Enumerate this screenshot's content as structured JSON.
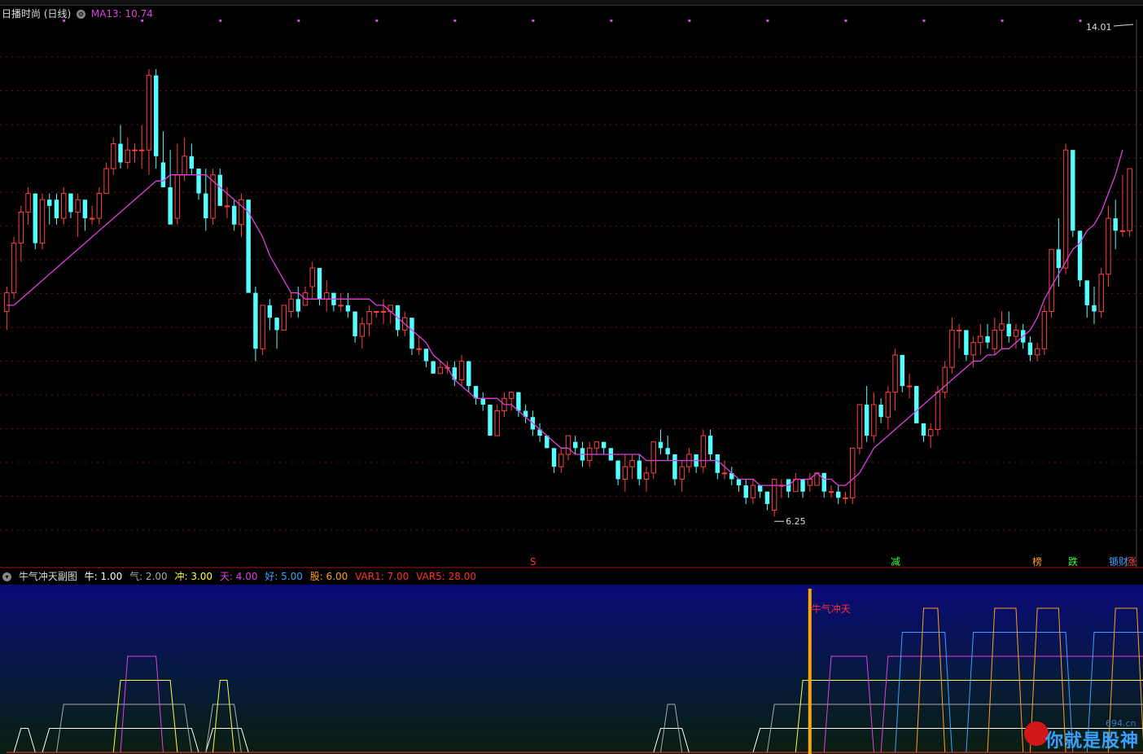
{
  "title": "日播时尚 (日线)",
  "ma": {
    "label": "MA13: 10.74",
    "color": "#e040e0"
  },
  "price_labels": {
    "high": "14.01",
    "low": "6.25"
  },
  "markers": {
    "s": "S",
    "jian": "减",
    "mai": "榜",
    "die": "跌",
    "cai": "锧财",
    "zhang": "涨"
  },
  "sub": {
    "title": "牛气冲天副图",
    "items": [
      {
        "label": "牛: 1.00",
        "color": "#ffffff"
      },
      {
        "label": "气: 2.00",
        "color": "#aaaaaa"
      },
      {
        "label": "冲: 3.00",
        "color": "#ffff40"
      },
      {
        "label": "天: 4.00",
        "color": "#e040e0"
      },
      {
        "label": "好: 5.00",
        "color": "#40a0ff"
      },
      {
        "label": "股: 6.00",
        "color": "#ffa020"
      },
      {
        "label": "VAR1: 7.00",
        "color": "#ff3030"
      },
      {
        "label": "VAR5: 28.00",
        "color": "#ff3030"
      }
    ],
    "signal_label": "牛气冲天"
  },
  "watermark": {
    "text": "你就是股神",
    "site": "694.cn"
  },
  "chart_data": {
    "type": "candlestick",
    "title": "日播时尚 (日线)",
    "up_color": "#ff4040",
    "down_color": "#54ffff",
    "ma_color": "#e040e0",
    "y_range": [
      5.7,
      14.3
    ],
    "candles": [
      [
        9.6,
        10.0,
        9.3,
        9.9
      ],
      [
        9.9,
        10.8,
        9.8,
        10.7
      ],
      [
        10.7,
        11.3,
        10.4,
        11.2
      ],
      [
        11.2,
        11.6,
        11.0,
        11.5
      ],
      [
        11.5,
        11.3,
        10.6,
        10.7
      ],
      [
        10.7,
        11.5,
        10.6,
        11.4
      ],
      [
        11.4,
        11.5,
        11.0,
        11.3
      ],
      [
        11.4,
        11.5,
        11.0,
        11.1
      ],
      [
        11.1,
        11.6,
        11.0,
        11.5
      ],
      [
        11.5,
        11.4,
        11.1,
        11.2
      ],
      [
        11.2,
        11.5,
        10.8,
        11.4
      ],
      [
        11.4,
        11.4,
        10.9,
        11.1
      ],
      [
        11.1,
        11.3,
        11.0,
        11.1
      ],
      [
        11.1,
        11.6,
        11.0,
        11.5
      ],
      [
        11.5,
        12.0,
        11.5,
        11.9
      ],
      [
        11.9,
        12.4,
        11.8,
        12.3
      ],
      [
        12.3,
        12.6,
        11.9,
        12.0
      ],
      [
        12.0,
        12.4,
        11.9,
        12.2
      ],
      [
        12.2,
        12.3,
        12.0,
        12.2
      ],
      [
        12.2,
        12.6,
        11.9,
        12.2
      ],
      [
        12.2,
        13.5,
        11.8,
        13.4
      ],
      [
        13.4,
        13.5,
        11.9,
        12.1
      ],
      [
        12.0,
        12.5,
        11.6,
        11.6
      ],
      [
        11.6,
        12.2,
        11.0,
        11.0
      ],
      [
        11.1,
        12.3,
        11.0,
        11.8
      ],
      [
        11.8,
        12.4,
        11.7,
        12.1
      ],
      [
        12.1,
        12.3,
        11.8,
        11.9
      ],
      [
        11.9,
        11.8,
        11.4,
        11.5
      ],
      [
        11.5,
        11.9,
        10.9,
        11.1
      ],
      [
        11.1,
        11.9,
        11.0,
        11.8
      ],
      [
        11.8,
        11.9,
        11.3,
        11.3
      ],
      [
        11.3,
        11.6,
        11.1,
        11.3
      ],
      [
        11.3,
        11.4,
        10.9,
        11.0
      ],
      [
        11.0,
        11.5,
        10.8,
        11.4
      ],
      [
        11.4,
        11.3,
        9.9,
        9.9
      ],
      [
        9.9,
        10.0,
        8.8,
        9.0
      ],
      [
        9.0,
        9.7,
        8.9,
        9.7
      ],
      [
        9.7,
        9.8,
        9.3,
        9.5
      ],
      [
        9.5,
        9.4,
        9.0,
        9.3
      ],
      [
        9.3,
        9.7,
        9.3,
        9.7
      ],
      [
        9.6,
        9.9,
        9.5,
        9.8
      ],
      [
        9.8,
        10.0,
        9.5,
        9.6
      ],
      [
        9.7,
        10.0,
        9.7,
        9.9
      ],
      [
        10.0,
        10.4,
        9.8,
        10.3
      ],
      [
        10.3,
        10.3,
        9.7,
        9.8
      ],
      [
        9.8,
        10.1,
        9.6,
        9.9
      ],
      [
        9.9,
        9.9,
        9.6,
        9.7
      ],
      [
        9.7,
        9.9,
        9.6,
        9.7
      ],
      [
        9.7,
        9.9,
        9.5,
        9.6
      ],
      [
        9.6,
        9.6,
        9.1,
        9.2
      ],
      [
        9.2,
        9.5,
        9.0,
        9.4
      ],
      [
        9.4,
        9.7,
        9.2,
        9.6
      ],
      [
        9.6,
        9.6,
        9.5,
        9.6
      ],
      [
        9.6,
        9.8,
        9.4,
        9.6
      ],
      [
        9.6,
        9.6,
        9.4,
        9.7
      ],
      [
        9.7,
        9.6,
        9.2,
        9.3
      ],
      [
        9.3,
        9.6,
        9.2,
        9.5
      ],
      [
        9.5,
        9.3,
        8.9,
        9.0
      ],
      [
        9.0,
        9.2,
        8.9,
        9.0
      ],
      [
        9.0,
        8.9,
        8.7,
        8.8
      ],
      [
        8.8,
        8.8,
        8.6,
        8.6
      ],
      [
        8.6,
        8.8,
        8.6,
        8.7
      ],
      [
        8.7,
        8.8,
        8.6,
        8.7
      ],
      [
        8.7,
        8.8,
        8.4,
        8.5
      ],
      [
        8.5,
        8.9,
        8.4,
        8.8
      ],
      [
        8.8,
        8.8,
        8.3,
        8.4
      ],
      [
        8.4,
        8.4,
        8.1,
        8.2
      ],
      [
        8.2,
        8.3,
        8.0,
        8.1
      ],
      [
        8.1,
        8.1,
        7.6,
        7.6
      ],
      [
        7.6,
        8.1,
        7.6,
        8.0
      ],
      [
        8.0,
        8.3,
        7.9,
        8.2
      ],
      [
        8.2,
        8.3,
        8.0,
        8.3
      ],
      [
        8.3,
        8.3,
        7.9,
        8.0
      ],
      [
        8.0,
        8.1,
        7.8,
        7.9
      ],
      [
        7.9,
        8.0,
        7.6,
        7.7
      ],
      [
        7.7,
        7.8,
        7.5,
        7.6
      ],
      [
        7.6,
        7.6,
        7.4,
        7.4
      ],
      [
        7.4,
        7.3,
        7.0,
        7.1
      ],
      [
        7.1,
        7.4,
        7.0,
        7.3
      ],
      [
        7.3,
        7.6,
        7.2,
        7.6
      ],
      [
        7.5,
        7.6,
        7.3,
        7.4
      ],
      [
        7.4,
        7.5,
        7.1,
        7.2
      ],
      [
        7.2,
        7.5,
        7.1,
        7.4
      ],
      [
        7.4,
        7.5,
        7.3,
        7.5
      ],
      [
        7.5,
        7.5,
        7.3,
        7.4
      ],
      [
        7.4,
        7.4,
        7.2,
        7.2
      ],
      [
        7.2,
        7.2,
        6.8,
        6.9
      ],
      [
        6.9,
        7.3,
        6.7,
        7.1
      ],
      [
        7.1,
        7.3,
        6.9,
        7.2
      ],
      [
        7.2,
        7.3,
        6.8,
        6.9
      ],
      [
        6.9,
        7.1,
        6.7,
        7.0
      ],
      [
        7.0,
        7.5,
        6.9,
        7.5
      ],
      [
        7.5,
        7.7,
        7.3,
        7.4
      ],
      [
        7.4,
        7.6,
        7.2,
        7.3
      ],
      [
        7.3,
        7.3,
        6.8,
        6.9
      ],
      [
        6.9,
        7.2,
        6.7,
        7.1
      ],
      [
        7.1,
        7.4,
        7.0,
        7.3
      ],
      [
        7.3,
        7.3,
        7.0,
        7.1
      ],
      [
        7.1,
        7.7,
        7.0,
        7.6
      ],
      [
        7.6,
        7.7,
        7.2,
        7.3
      ],
      [
        7.3,
        7.2,
        6.9,
        7.0
      ],
      [
        7.0,
        7.2,
        6.9,
        7.0
      ],
      [
        7.0,
        7.1,
        6.8,
        6.9
      ],
      [
        6.9,
        6.9,
        6.7,
        6.8
      ],
      [
        6.8,
        6.9,
        6.5,
        6.6
      ],
      [
        6.6,
        6.9,
        6.5,
        6.8
      ],
      [
        6.8,
        6.8,
        6.6,
        6.7
      ],
      [
        6.7,
        6.7,
        6.4,
        6.5
      ],
      [
        6.4,
        6.9,
        6.3,
        6.9
      ],
      [
        6.8,
        6.9,
        6.6,
        6.8
      ],
      [
        6.9,
        6.8,
        6.6,
        6.7
      ],
      [
        6.7,
        7.0,
        6.7,
        6.9
      ],
      [
        6.9,
        6.9,
        6.6,
        6.7
      ],
      [
        6.8,
        7.0,
        6.7,
        6.9
      ],
      [
        6.8,
        7.0,
        6.8,
        7.0
      ],
      [
        7.0,
        6.9,
        6.6,
        6.7
      ],
      [
        6.7,
        6.8,
        6.6,
        6.7
      ],
      [
        6.7,
        6.8,
        6.5,
        6.6
      ],
      [
        6.6,
        6.7,
        6.5,
        6.6
      ],
      [
        6.6,
        7.4,
        6.5,
        7.4
      ],
      [
        7.4,
        8.1,
        7.3,
        8.1
      ],
      [
        8.1,
        8.4,
        7.5,
        7.6
      ],
      [
        7.6,
        8.3,
        7.5,
        8.1
      ],
      [
        8.1,
        8.2,
        7.8,
        7.9
      ],
      [
        7.9,
        8.4,
        7.7,
        8.3
      ],
      [
        8.3,
        9.0,
        8.0,
        8.9
      ],
      [
        8.9,
        8.8,
        8.3,
        8.4
      ],
      [
        8.4,
        8.6,
        8.2,
        8.4
      ],
      [
        8.4,
        8.4,
        7.8,
        7.8
      ],
      [
        7.8,
        7.7,
        7.5,
        7.6
      ],
      [
        7.6,
        7.8,
        7.4,
        7.7
      ],
      [
        7.7,
        8.4,
        7.6,
        8.3
      ],
      [
        8.3,
        8.8,
        8.2,
        8.7
      ],
      [
        8.7,
        9.5,
        8.6,
        9.3
      ],
      [
        9.3,
        9.4,
        9.0,
        9.3
      ],
      [
        9.3,
        9.2,
        8.8,
        8.9
      ],
      [
        8.9,
        9.2,
        8.7,
        9.1
      ],
      [
        9.1,
        9.4,
        8.9,
        9.2
      ],
      [
        9.2,
        9.4,
        9.0,
        9.1
      ],
      [
        9.0,
        9.5,
        8.9,
        9.3
      ],
      [
        9.3,
        9.6,
        9.0,
        9.4
      ],
      [
        9.4,
        9.6,
        9.1,
        9.2
      ],
      [
        9.2,
        9.4,
        9.0,
        9.3
      ],
      [
        9.3,
        9.4,
        9.0,
        9.1
      ],
      [
        9.1,
        9.2,
        8.8,
        8.9
      ],
      [
        8.9,
        9.1,
        8.8,
        9.0
      ],
      [
        9.0,
        9.7,
        8.9,
        9.6
      ],
      [
        9.6,
        10.6,
        9.5,
        10.6
      ],
      [
        10.6,
        11.1,
        10.0,
        10.3
      ],
      [
        10.3,
        12.3,
        10.2,
        12.2
      ],
      [
        12.2,
        12.2,
        10.8,
        10.9
      ],
      [
        10.9,
        10.8,
        10.0,
        10.1
      ],
      [
        10.1,
        10.1,
        9.5,
        9.7
      ],
      [
        9.7,
        10.0,
        9.4,
        9.6
      ],
      [
        9.6,
        10.3,
        9.5,
        10.2
      ],
      [
        10.2,
        11.3,
        10.0,
        11.1
      ],
      [
        11.1,
        11.4,
        10.6,
        10.9
      ],
      [
        10.9,
        11.8,
        10.8,
        10.9
      ],
      [
        10.9,
        11.9,
        10.8,
        11.9
      ]
    ],
    "ma13_line": [
      9.7,
      9.7,
      9.8,
      9.9,
      10.0,
      10.1,
      10.2,
      10.3,
      10.4,
      10.5,
      10.6,
      10.7,
      10.8,
      10.9,
      11.0,
      11.1,
      11.2,
      11.3,
      11.4,
      11.5,
      11.6,
      11.7,
      11.7,
      11.8,
      11.8,
      11.8,
      11.8,
      11.8,
      11.8,
      11.7,
      11.6,
      11.5,
      11.4,
      11.3,
      11.2,
      11.0,
      10.8,
      10.5,
      10.3,
      10.1,
      9.9,
      9.9,
      9.8,
      9.8,
      9.8,
      9.8,
      9.8,
      9.8,
      9.8,
      9.8,
      9.8,
      9.8,
      9.7,
      9.7,
      9.6,
      9.5,
      9.4,
      9.3,
      9.2,
      9.1,
      8.9,
      8.8,
      8.7,
      8.5,
      8.4,
      8.3,
      8.2,
      8.2,
      8.2,
      8.2,
      8.1,
      8.1,
      8.0,
      7.9,
      7.8,
      7.7,
      7.6,
      7.5,
      7.4,
      7.4,
      7.3,
      7.3,
      7.3,
      7.3,
      7.3,
      7.3,
      7.3,
      7.3,
      7.3,
      7.3,
      7.2,
      7.2,
      7.2,
      7.2,
      7.2,
      7.2,
      7.2,
      7.2,
      7.2,
      7.2,
      7.2,
      7.1,
      7.0,
      6.9,
      6.9,
      6.9,
      6.8,
      6.8,
      6.8,
      6.8,
      6.8,
      6.9,
      6.9,
      6.9,
      7.0,
      6.9,
      6.9,
      6.8,
      6.8,
      6.9,
      7.0,
      7.2,
      7.4,
      7.5,
      7.6,
      7.7,
      7.8,
      7.9,
      8.0,
      8.1,
      8.2,
      8.3,
      8.4,
      8.5,
      8.6,
      8.7,
      8.8,
      8.8,
      8.9,
      8.9,
      9.0,
      9.0,
      9.1,
      9.2,
      9.3,
      9.5,
      9.8,
      10.0,
      10.2,
      10.4,
      10.6,
      10.7,
      10.9,
      11.0,
      11.2,
      11.5,
      11.8,
      12.2
    ],
    "high_label": "14.01",
    "low_label": "6.25",
    "sub_series": [
      {
        "name": "牛",
        "value": 1.0,
        "color": "#ffffff"
      },
      {
        "name": "气",
        "value": 2.0,
        "color": "#aaaaaa"
      },
      {
        "name": "冲",
        "value": 3.0,
        "color": "#ffff40"
      },
      {
        "name": "天",
        "value": 4.0,
        "color": "#e040e0"
      },
      {
        "name": "好",
        "value": 5.0,
        "color": "#40a0ff"
      },
      {
        "name": "股",
        "value": 6.0,
        "color": "#ffa020"
      },
      {
        "name": "VAR1",
        "value": 7.0,
        "color": "#ff3030"
      }
    ],
    "sub_levels": [
      0,
      0,
      1,
      1,
      0,
      0,
      1,
      1,
      2,
      2,
      2,
      2,
      2,
      2,
      2,
      2,
      3,
      4,
      4,
      4,
      4,
      4,
      3,
      3,
      2,
      2,
      1,
      0,
      0,
      2,
      3,
      3,
      2,
      1,
      0,
      0,
      0,
      0,
      0,
      0,
      0,
      0,
      0,
      0,
      0,
      0,
      0,
      0,
      0,
      0,
      0,
      0,
      0,
      0,
      0,
      0,
      0,
      0,
      0,
      0,
      0,
      0,
      0,
      0,
      0,
      0,
      0,
      0,
      0,
      0,
      0,
      0,
      0,
      0,
      0,
      0,
      0,
      0,
      0,
      0,
      0,
      0,
      0,
      0,
      0,
      0,
      0,
      0,
      0,
      0,
      0,
      0,
      1,
      2,
      2,
      1,
      0,
      0,
      0,
      0,
      0,
      0,
      0,
      0,
      0,
      0,
      1,
      1,
      2,
      2,
      2,
      2,
      3,
      3,
      3,
      3,
      4,
      4,
      4,
      4,
      4,
      4,
      3,
      3,
      4,
      4,
      5,
      5,
      5,
      6,
      6,
      6,
      5,
      4,
      4,
      4,
      5,
      5,
      5,
      6,
      6,
      6,
      6,
      5,
      5,
      6,
      6,
      6,
      6,
      5,
      4,
      4,
      4,
      5,
      5,
      5,
      6,
      6,
      6,
      6,
      5,
      6,
      6,
      6,
      6,
      6,
      6,
      6,
      6,
      6,
      6,
      6,
      6,
      6,
      6,
      6
    ],
    "signal_index": 113
  }
}
